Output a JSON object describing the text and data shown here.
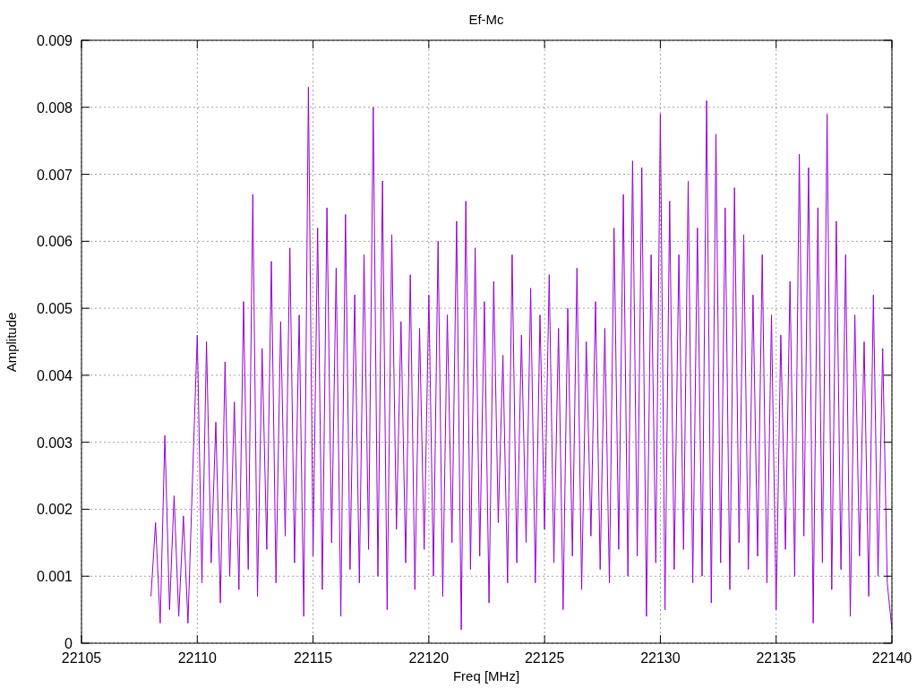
{
  "chart_data": {
    "type": "line",
    "title": "Ef-Mc",
    "xlabel": "Freq [MHz]",
    "ylabel": "Amplitude",
    "grid": true,
    "xlim": [
      22105,
      22140
    ],
    "ylim": [
      0,
      0.009
    ],
    "xticks": [
      {
        "value": 22105,
        "label": "22105"
      },
      {
        "value": 22110,
        "label": "22110"
      },
      {
        "value": 22115,
        "label": "22115"
      },
      {
        "value": 22120,
        "label": "22120"
      },
      {
        "value": 22125,
        "label": "22125"
      },
      {
        "value": 22130,
        "label": "22130"
      },
      {
        "value": 22135,
        "label": "22135"
      },
      {
        "value": 22140,
        "label": "22140"
      }
    ],
    "yticks": [
      {
        "value": 0,
        "label": "0"
      },
      {
        "value": 0.001,
        "label": "0.001"
      },
      {
        "value": 0.002,
        "label": "0.002"
      },
      {
        "value": 0.003,
        "label": "0.003"
      },
      {
        "value": 0.004,
        "label": "0.004"
      },
      {
        "value": 0.005,
        "label": "0.005"
      },
      {
        "value": 0.006,
        "label": "0.006"
      },
      {
        "value": 0.007,
        "label": "0.007"
      },
      {
        "value": 0.008,
        "label": "0.008"
      },
      {
        "value": 0.009,
        "label": "0.009"
      }
    ],
    "x": [
      22108,
      22108.2,
      22108.4,
      22108.6,
      22108.8,
      22109,
      22109.2,
      22109.4,
      22109.6,
      22109.8,
      22110,
      22110.2,
      22110.4,
      22110.6,
      22110.8,
      22111,
      22111.2,
      22111.4,
      22111.6,
      22111.8,
      22112,
      22112.2,
      22112.4,
      22112.6,
      22112.8,
      22113,
      22113.2,
      22113.4,
      22113.6,
      22113.8,
      22114,
      22114.2,
      22114.4,
      22114.6,
      22114.8,
      22115,
      22115.2,
      22115.4,
      22115.6,
      22115.8,
      22116,
      22116.2,
      22116.4,
      22116.6,
      22116.8,
      22117,
      22117.2,
      22117.4,
      22117.6,
      22117.8,
      22118,
      22118.2,
      22118.4,
      22118.6,
      22118.8,
      22119,
      22119.2,
      22119.4,
      22119.6,
      22119.8,
      22120,
      22120.2,
      22120.4,
      22120.6,
      22120.8,
      22121,
      22121.2,
      22121.4,
      22121.6,
      22121.8,
      22122,
      22122.2,
      22122.4,
      22122.6,
      22122.8,
      22123,
      22123.2,
      22123.4,
      22123.6,
      22123.8,
      22124,
      22124.2,
      22124.4,
      22124.6,
      22124.8,
      22125,
      22125.2,
      22125.4,
      22125.6,
      22125.8,
      22126,
      22126.2,
      22126.4,
      22126.6,
      22126.8,
      22127,
      22127.2,
      22127.4,
      22127.6,
      22127.8,
      22128,
      22128.2,
      22128.4,
      22128.6,
      22128.8,
      22129,
      22129.2,
      22129.4,
      22129.6,
      22129.8,
      22130,
      22130.2,
      22130.4,
      22130.6,
      22130.8,
      22131,
      22131.2,
      22131.4,
      22131.6,
      22131.8,
      22132,
      22132.2,
      22132.4,
      22132.6,
      22132.8,
      22133,
      22133.2,
      22133.4,
      22133.6,
      22133.8,
      22134,
      22134.2,
      22134.4,
      22134.6,
      22134.8,
      22135,
      22135.2,
      22135.4,
      22135.6,
      22135.8,
      22136,
      22136.2,
      22136.4,
      22136.6,
      22136.8,
      22137,
      22137.2,
      22137.4,
      22137.6,
      22137.8,
      22138,
      22138.2,
      22138.4,
      22138.6,
      22138.8,
      22139,
      22139.2,
      22139.4,
      22139.6,
      22139.8,
      22140
    ],
    "series": [
      {
        "color": "#9400d3",
        "values": [
          0.0007,
          0.0018,
          0.0003,
          0.0031,
          0.0005,
          0.0022,
          0.0004,
          0.0019,
          0.0003,
          0.0025,
          0.0046,
          0.0009,
          0.0045,
          0.0012,
          0.0033,
          0.0006,
          0.0042,
          0.001,
          0.0036,
          0.0008,
          0.0051,
          0.0011,
          0.0067,
          0.0007,
          0.0044,
          0.0014,
          0.0057,
          0.0009,
          0.0048,
          0.0016,
          0.0059,
          0.0012,
          0.0049,
          0.0004,
          0.0083,
          0.0013,
          0.0062,
          0.0008,
          0.0065,
          0.0015,
          0.0056,
          0.0004,
          0.0064,
          0.0011,
          0.0052,
          0.0009,
          0.0058,
          0.0014,
          0.008,
          0.001,
          0.0069,
          0.0005,
          0.0061,
          0.0017,
          0.0048,
          0.0012,
          0.0055,
          0.0008,
          0.0047,
          0.0014,
          0.0052,
          0.001,
          0.006,
          0.0007,
          0.0049,
          0.0015,
          0.0063,
          0.0002,
          0.0066,
          0.0011,
          0.0059,
          0.0013,
          0.0051,
          0.0006,
          0.0054,
          0.0018,
          0.0043,
          0.0009,
          0.0058,
          0.0012,
          0.0046,
          0.0015,
          0.0053,
          0.0009,
          0.0049,
          0.0017,
          0.0055,
          0.0012,
          0.0047,
          0.0005,
          0.005,
          0.0013,
          0.0056,
          0.0008,
          0.0045,
          0.0016,
          0.0051,
          0.0011,
          0.0047,
          0.0009,
          0.0062,
          0.0014,
          0.0067,
          0.001,
          0.0072,
          0.0013,
          0.0071,
          0.0004,
          0.0058,
          0.0012,
          0.0079,
          0.0005,
          0.0066,
          0.0011,
          0.0058,
          0.0014,
          0.0069,
          0.0009,
          0.0062,
          0.001,
          0.0081,
          0.0006,
          0.0076,
          0.0012,
          0.0065,
          0.0008,
          0.0068,
          0.0015,
          0.0061,
          0.0011,
          0.0052,
          0.0013,
          0.0058,
          0.0009,
          0.0049,
          0.0005,
          0.0046,
          0.0014,
          0.0054,
          0.001,
          0.0073,
          0.0016,
          0.0071,
          0.0003,
          0.0065,
          0.0012,
          0.0079,
          0.0008,
          0.0063,
          0.0011,
          0.0058,
          0.0004,
          0.0049,
          0.0013,
          0.0045,
          0.0007,
          0.0052,
          0.001,
          0.0044,
          0.0009,
          0.0002
        ]
      }
    ]
  }
}
